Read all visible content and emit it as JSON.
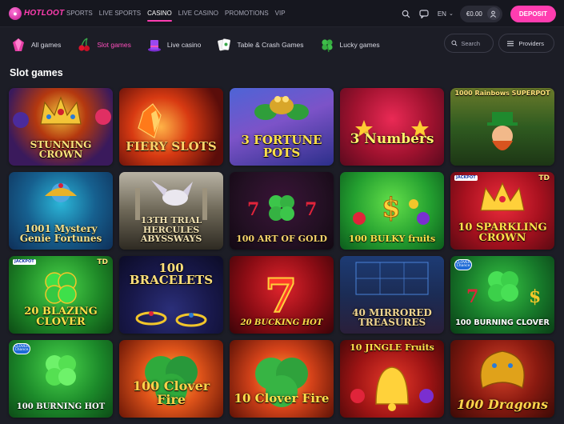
{
  "brand": {
    "logo_text": "HOTLOOT"
  },
  "topnav": {
    "items": [
      {
        "label": "SPORTS",
        "active": false
      },
      {
        "label": "LIVE SPORTS",
        "active": false
      },
      {
        "label": "CASINO",
        "active": true
      },
      {
        "label": "LIVE CASINO",
        "active": false
      },
      {
        "label": "PROMOTIONS",
        "active": false
      },
      {
        "label": "VIP",
        "active": false
      }
    ],
    "language": "EN",
    "balance": "€0.00",
    "deposit_label": "DEPOSIT"
  },
  "categories": {
    "items": [
      {
        "label": "All games",
        "icon": "gem-icon",
        "active": false
      },
      {
        "label": "Slot games",
        "icon": "cherries-icon",
        "active": true
      },
      {
        "label": "Live casino",
        "icon": "magic-hat-icon",
        "active": false
      },
      {
        "label": "Table & Crash Games",
        "icon": "cards-icon",
        "active": false
      },
      {
        "label": "Lucky games",
        "icon": "clover-icon",
        "active": false
      }
    ],
    "search_placeholder": "Search",
    "providers_label": "Providers"
  },
  "section_title": "Slot games",
  "badges": {
    "td": "TD",
    "jackpot": "JACKPOT",
    "clover_chance": "CLOVER Chance"
  },
  "games": [
    {
      "title": "STUNNING CROWN"
    },
    {
      "title": "FIERY SLOTS"
    },
    {
      "title": "3 FORTUNE POTS"
    },
    {
      "title": "3 Numbers"
    },
    {
      "title": "1000 Rainbows SUPERPOT"
    },
    {
      "title": "1001 Mystery Genie Fortunes"
    },
    {
      "title": "13TH TRIAL HERCULES ABYSSWAYS"
    },
    {
      "title": "100 ART OF GOLD"
    },
    {
      "title": "100 BULKY fruits"
    },
    {
      "title": "10 SPARKLING CROWN"
    },
    {
      "title": "20 BLAZING CLOVER"
    },
    {
      "title": "100 BRACELETS"
    },
    {
      "title": "20 BUCKING HOT"
    },
    {
      "title": "40 MIRRORED TREASURES"
    },
    {
      "title": "100 BURNING CLOVER"
    },
    {
      "title": "100 BURNING HOT"
    },
    {
      "title": "100 Clover Fire"
    },
    {
      "title": "10 Clover Fire"
    },
    {
      "title": "10 JINGLE Fruits"
    },
    {
      "title": "100 Dragons"
    }
  ]
}
